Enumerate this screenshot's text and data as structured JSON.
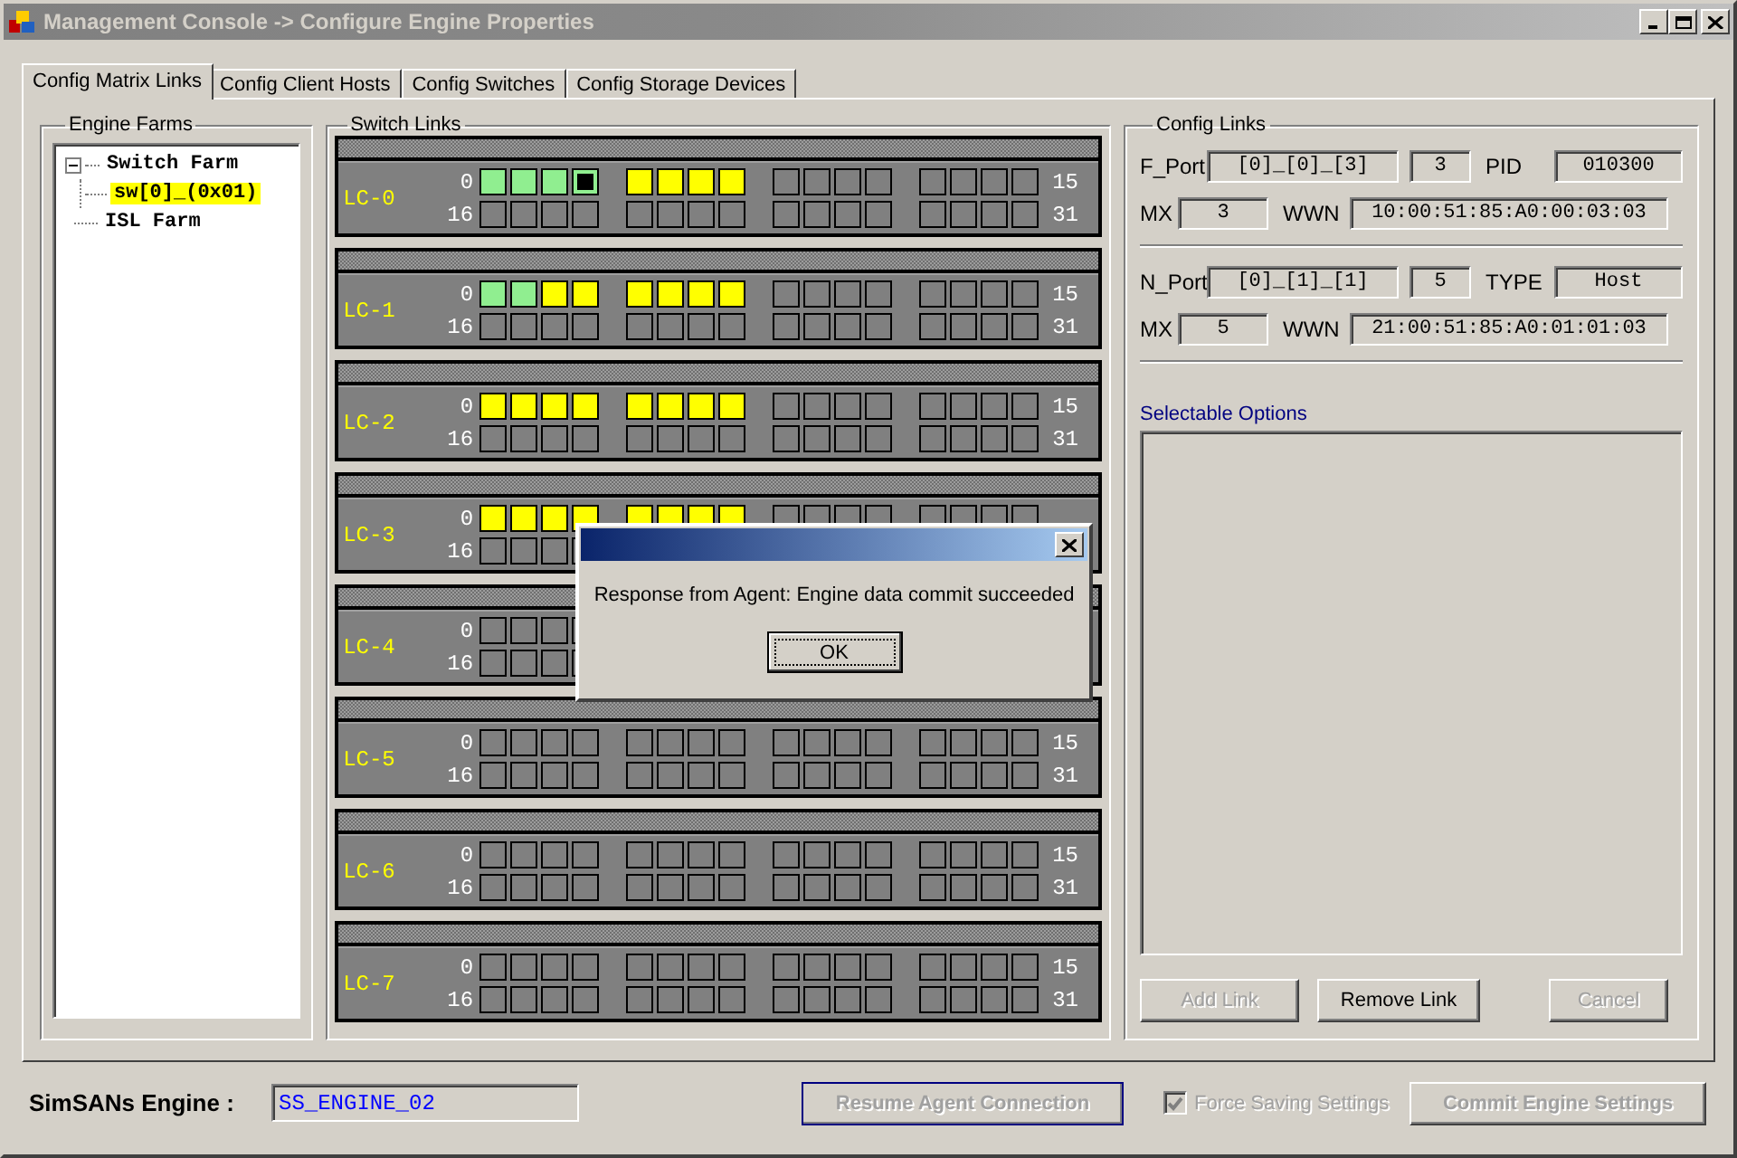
{
  "window": {
    "title": "Management Console -> Configure Engine Properties"
  },
  "tabs": [
    {
      "label": "Config Matrix Links",
      "selected": true
    },
    {
      "label": "Config Client Hosts",
      "selected": false
    },
    {
      "label": "Config Switches",
      "selected": false
    },
    {
      "label": "Config Storage Devices",
      "selected": false
    }
  ],
  "engine_farms": {
    "title": "Engine Farms",
    "tree": [
      {
        "label": "Switch Farm",
        "expanded": true,
        "selected": false,
        "children": [
          {
            "label": "sw[0]_(0x01)",
            "selected": true
          }
        ]
      },
      {
        "label": "ISL Farm",
        "selected": false
      }
    ]
  },
  "switch_links": {
    "title": "Switch Links",
    "cards": [
      {
        "name": "LC-0",
        "rows": [
          {
            "start": "0",
            "end": "15",
            "ports": [
              {
                "color": "#90ee90",
                "selected": false
              },
              {
                "color": "#90ee90",
                "selected": false
              },
              {
                "color": "#90ee90",
                "selected": false
              },
              {
                "color": "#90ee90",
                "selected": true
              },
              {
                "color": "#ffff00",
                "selected": false
              },
              {
                "color": "#ffff00",
                "selected": false
              },
              {
                "color": "#ffff00",
                "selected": false
              },
              {
                "color": "#ffff00",
                "selected": false
              },
              {
                "color": "#808080",
                "selected": false
              },
              {
                "color": "#808080",
                "selected": false
              },
              {
                "color": "#808080",
                "selected": false
              },
              {
                "color": "#808080",
                "selected": false
              },
              {
                "color": "#808080",
                "selected": false
              },
              {
                "color": "#808080",
                "selected": false
              },
              {
                "color": "#808080",
                "selected": false
              },
              {
                "color": "#808080",
                "selected": false
              }
            ]
          },
          {
            "start": "16",
            "end": "31",
            "ports": [
              {
                "color": "#808080",
                "selected": false
              },
              {
                "color": "#808080",
                "selected": false
              },
              {
                "color": "#808080",
                "selected": false
              },
              {
                "color": "#808080",
                "selected": false
              },
              {
                "color": "#808080",
                "selected": false
              },
              {
                "color": "#808080",
                "selected": false
              },
              {
                "color": "#808080",
                "selected": false
              },
              {
                "color": "#808080",
                "selected": false
              },
              {
                "color": "#808080",
                "selected": false
              },
              {
                "color": "#808080",
                "selected": false
              },
              {
                "color": "#808080",
                "selected": false
              },
              {
                "color": "#808080",
                "selected": false
              },
              {
                "color": "#808080",
                "selected": false
              },
              {
                "color": "#808080",
                "selected": false
              },
              {
                "color": "#808080",
                "selected": false
              },
              {
                "color": "#808080",
                "selected": false
              }
            ]
          }
        ]
      },
      {
        "name": "LC-1",
        "rows": [
          {
            "start": "0",
            "end": "15",
            "ports": [
              {
                "color": "#90ee90",
                "selected": false
              },
              {
                "color": "#90ee90",
                "selected": false
              },
              {
                "color": "#ffff00",
                "selected": false
              },
              {
                "color": "#ffff00",
                "selected": false
              },
              {
                "color": "#ffff00",
                "selected": false
              },
              {
                "color": "#ffff00",
                "selected": false
              },
              {
                "color": "#ffff00",
                "selected": false
              },
              {
                "color": "#ffff00",
                "selected": false
              },
              {
                "color": "#808080",
                "selected": false
              },
              {
                "color": "#808080",
                "selected": false
              },
              {
                "color": "#808080",
                "selected": false
              },
              {
                "color": "#808080",
                "selected": false
              },
              {
                "color": "#808080",
                "selected": false
              },
              {
                "color": "#808080",
                "selected": false
              },
              {
                "color": "#808080",
                "selected": false
              },
              {
                "color": "#808080",
                "selected": false
              }
            ]
          },
          {
            "start": "16",
            "end": "31",
            "ports": [
              {
                "color": "#808080",
                "selected": false
              },
              {
                "color": "#808080",
                "selected": false
              },
              {
                "color": "#808080",
                "selected": false
              },
              {
                "color": "#808080",
                "selected": false
              },
              {
                "color": "#808080",
                "selected": false
              },
              {
                "color": "#808080",
                "selected": false
              },
              {
                "color": "#808080",
                "selected": false
              },
              {
                "color": "#808080",
                "selected": false
              },
              {
                "color": "#808080",
                "selected": false
              },
              {
                "color": "#808080",
                "selected": false
              },
              {
                "color": "#808080",
                "selected": false
              },
              {
                "color": "#808080",
                "selected": false
              },
              {
                "color": "#808080",
                "selected": false
              },
              {
                "color": "#808080",
                "selected": false
              },
              {
                "color": "#808080",
                "selected": false
              },
              {
                "color": "#808080",
                "selected": false
              }
            ]
          }
        ]
      },
      {
        "name": "LC-2",
        "rows": [
          {
            "start": "0",
            "end": "15",
            "ports": [
              {
                "color": "#ffff00",
                "selected": false
              },
              {
                "color": "#ffff00",
                "selected": false
              },
              {
                "color": "#ffff00",
                "selected": false
              },
              {
                "color": "#ffff00",
                "selected": false
              },
              {
                "color": "#ffff00",
                "selected": false
              },
              {
                "color": "#ffff00",
                "selected": false
              },
              {
                "color": "#ffff00",
                "selected": false
              },
              {
                "color": "#ffff00",
                "selected": false
              },
              {
                "color": "#808080",
                "selected": false
              },
              {
                "color": "#808080",
                "selected": false
              },
              {
                "color": "#808080",
                "selected": false
              },
              {
                "color": "#808080",
                "selected": false
              },
              {
                "color": "#808080",
                "selected": false
              },
              {
                "color": "#808080",
                "selected": false
              },
              {
                "color": "#808080",
                "selected": false
              },
              {
                "color": "#808080",
                "selected": false
              }
            ]
          },
          {
            "start": "16",
            "end": "31",
            "ports": [
              {
                "color": "#808080",
                "selected": false
              },
              {
                "color": "#808080",
                "selected": false
              },
              {
                "color": "#808080",
                "selected": false
              },
              {
                "color": "#808080",
                "selected": false
              },
              {
                "color": "#808080",
                "selected": false
              },
              {
                "color": "#808080",
                "selected": false
              },
              {
                "color": "#808080",
                "selected": false
              },
              {
                "color": "#808080",
                "selected": false
              },
              {
                "color": "#808080",
                "selected": false
              },
              {
                "color": "#808080",
                "selected": false
              },
              {
                "color": "#808080",
                "selected": false
              },
              {
                "color": "#808080",
                "selected": false
              },
              {
                "color": "#808080",
                "selected": false
              },
              {
                "color": "#808080",
                "selected": false
              },
              {
                "color": "#808080",
                "selected": false
              },
              {
                "color": "#808080",
                "selected": false
              }
            ]
          }
        ]
      },
      {
        "name": "LC-3",
        "rows": [
          {
            "start": "0",
            "ports": [
              {
                "color": "#ffff00",
                "selected": false
              },
              {
                "color": "#ffff00",
                "selected": false
              },
              {
                "color": "#ffff00",
                "selected": false
              },
              {
                "color": "#ffff00",
                "selected": false
              },
              {
                "color": "#ffff00",
                "selected": false
              },
              {
                "color": "#ffff00",
                "selected": false
              },
              {
                "color": "#ffff00",
                "selected": false
              },
              {
                "color": "#ffff00",
                "selected": false
              },
              {
                "color": "#808080",
                "selected": false
              },
              {
                "color": "#808080",
                "selected": false
              },
              {
                "color": "#808080",
                "selected": false
              },
              {
                "color": "#808080",
                "selected": false
              },
              {
                "color": "#808080",
                "selected": false
              },
              {
                "color": "#808080",
                "selected": false
              },
              {
                "color": "#808080",
                "selected": false
              },
              {
                "color": "#808080",
                "selected": false
              }
            ]
          },
          {
            "start": "16",
            "ports": [
              {
                "color": "#808080",
                "selected": false
              },
              {
                "color": "#808080",
                "selected": false
              },
              {
                "color": "#808080",
                "selected": false
              }
            ]
          }
        ]
      },
      {
        "name": "LC-4",
        "rows": [
          {
            "start": "0",
            "ports": [
              {
                "color": "#808080",
                "selected": false
              },
              {
                "color": "#808080",
                "selected": false
              },
              {
                "color": "#808080",
                "selected": false
              }
            ]
          },
          {
            "start": "16",
            "ports": [
              {
                "color": "#808080",
                "selected": false
              },
              {
                "color": "#808080",
                "selected": false
              },
              {
                "color": "#808080",
                "selected": false
              }
            ]
          }
        ]
      },
      {
        "name": "LC-5",
        "rows": [
          {
            "start": "0",
            "end": "15",
            "ports": [
              {
                "color": "#808080",
                "selected": false
              },
              {
                "color": "#808080",
                "selected": false
              },
              {
                "color": "#808080",
                "selected": false
              },
              {
                "color": "#808080",
                "selected": false
              },
              {
                "color": "#808080",
                "selected": false
              },
              {
                "color": "#808080",
                "selected": false
              },
              {
                "color": "#808080",
                "selected": false
              },
              {
                "color": "#808080",
                "selected": false
              },
              {
                "color": "#808080",
                "selected": false
              },
              {
                "color": "#808080",
                "selected": false
              },
              {
                "color": "#808080",
                "selected": false
              },
              {
                "color": "#808080",
                "selected": false
              },
              {
                "color": "#808080",
                "selected": false
              },
              {
                "color": "#808080",
                "selected": false
              },
              {
                "color": "#808080",
                "selected": false
              },
              {
                "color": "#808080",
                "selected": false
              }
            ]
          },
          {
            "start": "16",
            "end": "31",
            "ports": [
              {
                "color": "#808080",
                "selected": false
              },
              {
                "color": "#808080",
                "selected": false
              },
              {
                "color": "#808080",
                "selected": false
              },
              {
                "color": "#808080",
                "selected": false
              },
              {
                "color": "#808080",
                "selected": false
              },
              {
                "color": "#808080",
                "selected": false
              },
              {
                "color": "#808080",
                "selected": false
              },
              {
                "color": "#808080",
                "selected": false
              },
              {
                "color": "#808080",
                "selected": false
              },
              {
                "color": "#808080",
                "selected": false
              },
              {
                "color": "#808080",
                "selected": false
              },
              {
                "color": "#808080",
                "selected": false
              },
              {
                "color": "#808080",
                "selected": false
              },
              {
                "color": "#808080",
                "selected": false
              },
              {
                "color": "#808080",
                "selected": false
              },
              {
                "color": "#808080",
                "selected": false
              }
            ]
          }
        ]
      },
      {
        "name": "LC-6",
        "rows": [
          {
            "start": "0",
            "end": "15",
            "ports": [
              {
                "color": "#808080",
                "selected": false
              },
              {
                "color": "#808080",
                "selected": false
              },
              {
                "color": "#808080",
                "selected": false
              },
              {
                "color": "#808080",
                "selected": false
              },
              {
                "color": "#808080",
                "selected": false
              },
              {
                "color": "#808080",
                "selected": false
              },
              {
                "color": "#808080",
                "selected": false
              },
              {
                "color": "#808080",
                "selected": false
              },
              {
                "color": "#808080",
                "selected": false
              },
              {
                "color": "#808080",
                "selected": false
              },
              {
                "color": "#808080",
                "selected": false
              },
              {
                "color": "#808080",
                "selected": false
              },
              {
                "color": "#808080",
                "selected": false
              },
              {
                "color": "#808080",
                "selected": false
              },
              {
                "color": "#808080",
                "selected": false
              },
              {
                "color": "#808080",
                "selected": false
              }
            ]
          },
          {
            "start": "16",
            "end": "31",
            "ports": [
              {
                "color": "#808080",
                "selected": false
              },
              {
                "color": "#808080",
                "selected": false
              },
              {
                "color": "#808080",
                "selected": false
              },
              {
                "color": "#808080",
                "selected": false
              },
              {
                "color": "#808080",
                "selected": false
              },
              {
                "color": "#808080",
                "selected": false
              },
              {
                "color": "#808080",
                "selected": false
              },
              {
                "color": "#808080",
                "selected": false
              },
              {
                "color": "#808080",
                "selected": false
              },
              {
                "color": "#808080",
                "selected": false
              },
              {
                "color": "#808080",
                "selected": false
              },
              {
                "color": "#808080",
                "selected": false
              },
              {
                "color": "#808080",
                "selected": false
              },
              {
                "color": "#808080",
                "selected": false
              },
              {
                "color": "#808080",
                "selected": false
              },
              {
                "color": "#808080",
                "selected": false
              }
            ]
          }
        ]
      },
      {
        "name": "LC-7",
        "rows": [
          {
            "start": "0",
            "end": "15",
            "ports": [
              {
                "color": "#808080",
                "selected": false
              },
              {
                "color": "#808080",
                "selected": false
              },
              {
                "color": "#808080",
                "selected": false
              },
              {
                "color": "#808080",
                "selected": false
              },
              {
                "color": "#808080",
                "selected": false
              },
              {
                "color": "#808080",
                "selected": false
              },
              {
                "color": "#808080",
                "selected": false
              },
              {
                "color": "#808080",
                "selected": false
              },
              {
                "color": "#808080",
                "selected": false
              },
              {
                "color": "#808080",
                "selected": false
              },
              {
                "color": "#808080",
                "selected": false
              },
              {
                "color": "#808080",
                "selected": false
              },
              {
                "color": "#808080",
                "selected": false
              },
              {
                "color": "#808080",
                "selected": false
              },
              {
                "color": "#808080",
                "selected": false
              },
              {
                "color": "#808080",
                "selected": false
              }
            ]
          },
          {
            "start": "16",
            "end": "31",
            "ports": [
              {
                "color": "#808080",
                "selected": false
              },
              {
                "color": "#808080",
                "selected": false
              },
              {
                "color": "#808080",
                "selected": false
              },
              {
                "color": "#808080",
                "selected": false
              },
              {
                "color": "#808080",
                "selected": false
              },
              {
                "color": "#808080",
                "selected": false
              },
              {
                "color": "#808080",
                "selected": false
              },
              {
                "color": "#808080",
                "selected": false
              },
              {
                "color": "#808080",
                "selected": false
              },
              {
                "color": "#808080",
                "selected": false
              },
              {
                "color": "#808080",
                "selected": false
              },
              {
                "color": "#808080",
                "selected": false
              },
              {
                "color": "#808080",
                "selected": false
              },
              {
                "color": "#808080",
                "selected": false
              },
              {
                "color": "#808080",
                "selected": false
              },
              {
                "color": "#808080",
                "selected": false
              }
            ]
          }
        ]
      }
    ]
  },
  "config_links": {
    "title": "Config Links",
    "blocks": [
      {
        "port_label": "F_Port",
        "port": "[0]_[0]_[3]",
        "index": "3",
        "extra_label": "PID",
        "extra": "010300",
        "mx_label": "MX",
        "mx": "3",
        "wwn_label": "WWN",
        "wwn": "10:00:51:85:A0:00:03:03"
      },
      {
        "port_label": "N_Port",
        "port": "[0]_[1]_[1]",
        "index": "5",
        "extra_label": "TYPE",
        "extra": "Host",
        "mx_label": "MX",
        "mx": "5",
        "wwn_label": "WWN",
        "wwn": "21:00:51:85:A0:01:01:03"
      }
    ],
    "options_label": "Selectable Options",
    "buttons": [
      {
        "label": "Add Link",
        "disabled": true
      },
      {
        "label": "Remove Link",
        "disabled": false
      },
      {
        "label": "Cancel",
        "disabled": true
      }
    ]
  },
  "bottom": {
    "engine_label": "SimSANs Engine :",
    "engine_value": "SS_ENGINE_02",
    "resume": {
      "label": "Resume Agent Connection",
      "disabled": true
    },
    "force": {
      "label": "Force Saving Settings",
      "checked": true,
      "disabled": true
    },
    "commit": {
      "label": "Commit Engine Settings",
      "disabled": true
    }
  },
  "dialog": {
    "message": "Response from Agent: Engine data commit succeeded",
    "button": "OK"
  }
}
